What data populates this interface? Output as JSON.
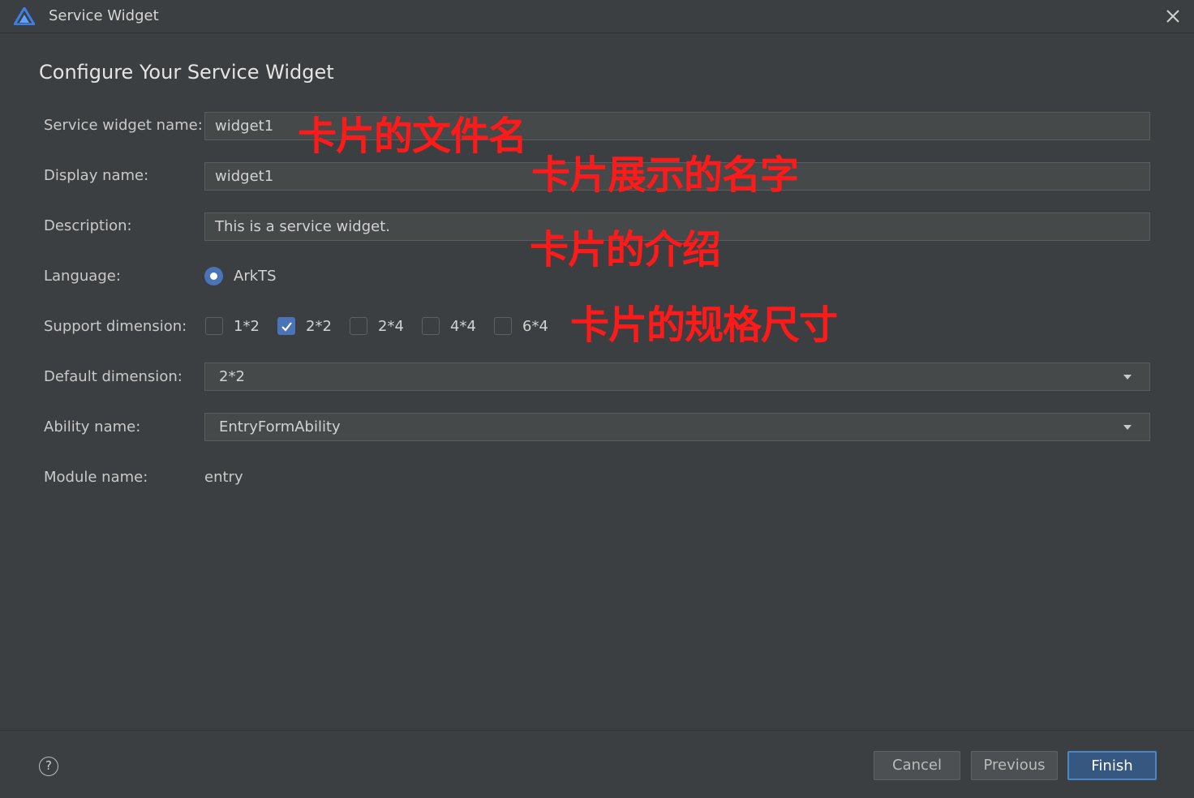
{
  "window": {
    "title": "Service Widget"
  },
  "page": {
    "heading": "Configure Your Service Widget"
  },
  "form": {
    "widget_name": {
      "label": "Service widget name:",
      "value": "widget1"
    },
    "display_name": {
      "label": "Display name:",
      "value": "widget1"
    },
    "description": {
      "label": "Description:",
      "value": "This is a service widget."
    },
    "language": {
      "label": "Language:",
      "selected": "ArkTS"
    },
    "support_dimension": {
      "label": "Support dimension:",
      "options": [
        {
          "label": "1*2",
          "checked": false
        },
        {
          "label": "2*2",
          "checked": true
        },
        {
          "label": "2*4",
          "checked": false
        },
        {
          "label": "4*4",
          "checked": false
        },
        {
          "label": "6*4",
          "checked": false
        }
      ]
    },
    "default_dimension": {
      "label": "Default dimension:",
      "value": "2*2"
    },
    "ability_name": {
      "label": "Ability name:",
      "value": "EntryFormAbility"
    },
    "module_name": {
      "label": "Module name:",
      "value": "entry"
    }
  },
  "annotations": {
    "file_name": "卡片的文件名",
    "display_name": "卡片展示的名字",
    "description": "卡片的介绍",
    "dimension": "卡片的规格尺寸"
  },
  "footer": {
    "help": "?",
    "cancel": "Cancel",
    "previous": "Previous",
    "finish": "Finish"
  },
  "colors": {
    "background": "#3c3f41",
    "accent": "#4a73b8",
    "annotation": "#ff1a1a"
  },
  "icons": {
    "logo": "app-logo-icon",
    "close": "close-icon",
    "help": "help-icon",
    "dropdown": "chevron-down-icon",
    "check": "check-icon"
  }
}
